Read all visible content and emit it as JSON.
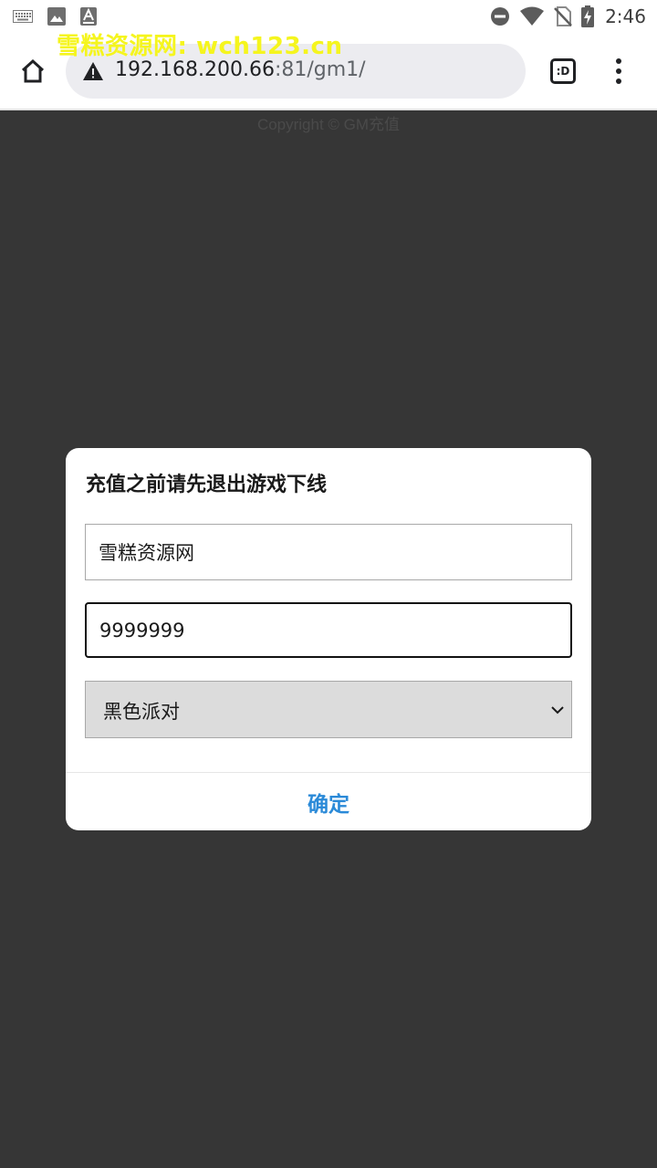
{
  "status_bar": {
    "time": "2:46",
    "left_icons": [
      "keyboard-icon",
      "image-icon",
      "font-icon"
    ],
    "right_icons": [
      "do-not-disturb-icon",
      "wifi-icon",
      "no-sim-icon",
      "battery-charging-icon"
    ]
  },
  "browser": {
    "url_host": "192.168.200.66",
    "url_rest": ":81/gm1/",
    "tabs_label": ":D"
  },
  "watermark": "雪糕资源网: wch123.cn",
  "page": {
    "copyright": "Copyright © GM充值"
  },
  "dialog": {
    "title": "充值之前请先退出游戏下线",
    "name_value": "雪糕资源网",
    "amount_value": "9999999",
    "select_value": "黑色派对",
    "confirm_label": "确定"
  },
  "colors": {
    "accent": "#2b8ad8",
    "watermark": "#f5f51e",
    "backdrop": "#363636"
  }
}
